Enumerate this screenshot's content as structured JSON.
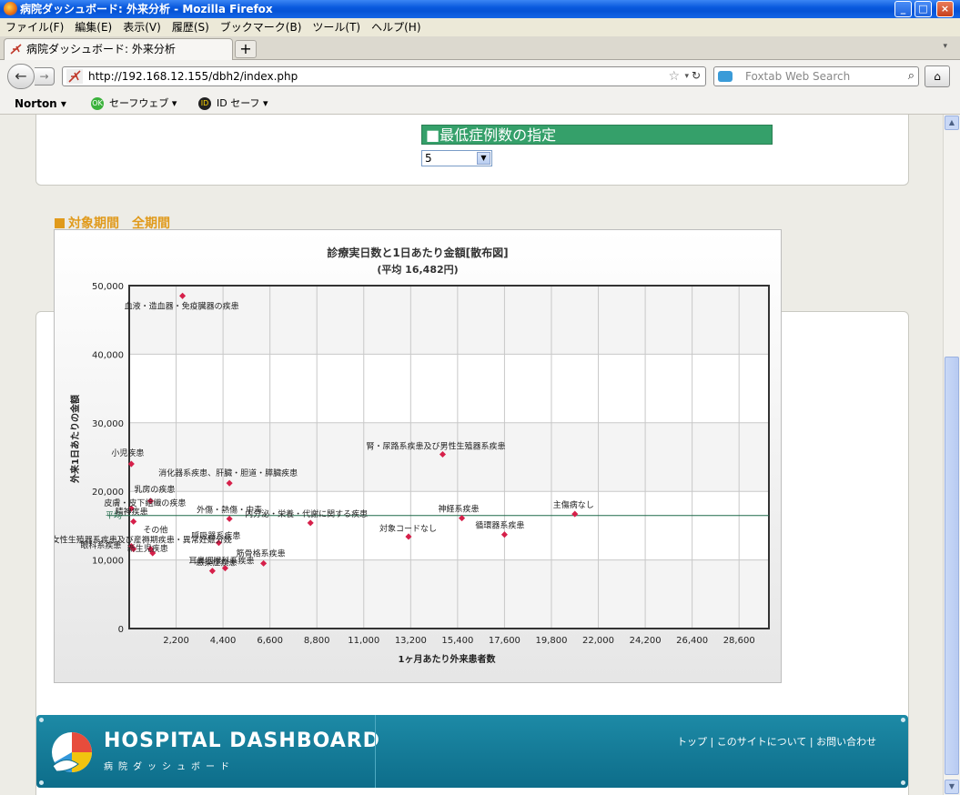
{
  "window": {
    "title": "病院ダッシュボード: 外来分析 - Mozilla Firefox",
    "min": "_",
    "max": "□",
    "close": "×"
  },
  "menu": [
    "ファイル(F)",
    "編集(E)",
    "表示(V)",
    "履歴(S)",
    "ブックマーク(B)",
    "ツール(T)",
    "ヘルプ(H)"
  ],
  "tab": {
    "title": "病院ダッシュボード: 外来分析",
    "new": "+"
  },
  "nav": {
    "url": "http://192.168.12.155/dbh2/index.php",
    "search_placeholder": "Foxtab Web Search",
    "back": "←",
    "forward": "→",
    "reload": "↻",
    "home": "⌂",
    "star": "☆",
    "drop": "▾",
    "mag": "⌕"
  },
  "toolbar2": {
    "norton": "Norton ▾",
    "safeweb": "セーフウェブ ▾",
    "safeweb_icon": "OK",
    "idsafe": "ID セーフ ▾",
    "idsafe_icon": "ID"
  },
  "filter": {
    "heading": "■最低症例数の指定",
    "value": "5",
    "arrow": "▼"
  },
  "period": {
    "label": "対象期間",
    "value": "全期間"
  },
  "chart_data": {
    "type": "scatter",
    "title": "診療実日数と1日あたり金額[散布図]",
    "subtitle": "(平均 16,482円)",
    "xlabel": "1ヶ月あたり外来患者数",
    "ylabel": "外来1日あたりの金額",
    "xticks": [
      "2,200",
      "4,400",
      "6,600",
      "8,800",
      "11,000",
      "13,200",
      "15,400",
      "17,600",
      "19,800",
      "22,000",
      "24,200",
      "26,400",
      "28,600"
    ],
    "yticks": [
      "0",
      "10,000",
      "20,000",
      "30,000",
      "40,000",
      "50,000"
    ],
    "xlim": [
      0,
      30000
    ],
    "ylim": [
      0,
      50000
    ],
    "average": 16482,
    "average_label": "平均",
    "points": [
      {
        "name": "血液・造血器・免疫臓器の疾患",
        "x": 2500,
        "y": 48500
      },
      {
        "name": "腎・尿路系疾患及び男性生殖器系疾患",
        "x": 14700,
        "y": 25400
      },
      {
        "name": "小児疾患",
        "x": 100,
        "y": 24000
      },
      {
        "name": "消化器系疾患、肝臓・胆道・膵臓疾患",
        "x": 4700,
        "y": 21200
      },
      {
        "name": "乳房の疾患",
        "x": 1000,
        "y": 18600
      },
      {
        "name": "皮膚・皮下組織の疾患",
        "x": 100,
        "y": 17500
      },
      {
        "name": "主傷病なし",
        "x": 20900,
        "y": 16700
      },
      {
        "name": "神経系疾患",
        "x": 15600,
        "y": 16100
      },
      {
        "name": "外傷・熱傷・中毒",
        "x": 4700,
        "y": 16000
      },
      {
        "name": "内分泌・栄養・代謝に関する疾患",
        "x": 8500,
        "y": 15400
      },
      {
        "name": "精神疾患",
        "x": 200,
        "y": 15600
      },
      {
        "name": "循環器系疾患",
        "x": 17600,
        "y": 13700
      },
      {
        "name": "対象コードなし",
        "x": 13100,
        "y": 13400
      },
      {
        "name": "呼吸器系疾患",
        "x": 4200,
        "y": 12500
      },
      {
        "name": "その他",
        "x": 1000,
        "y": 11600
      },
      {
        "name": "女性生殖器系疾患及び産褥期疾患・異常妊娠分娩",
        "x": 200,
        "y": 11600
      },
      {
        "name": "眼科系疾患",
        "x": 100,
        "y": 12000
      },
      {
        "name": "新生児疾患",
        "x": 1100,
        "y": 11000
      },
      {
        "name": "筋骨格系疾患",
        "x": 6300,
        "y": 9500
      },
      {
        "name": "耳鼻咽喉科系疾患",
        "x": 4500,
        "y": 8800
      },
      {
        "name": "感染症疾患",
        "x": 3900,
        "y": 8400
      }
    ]
  },
  "footer": {
    "logo": "HOSPITAL DASHBOARD",
    "logo_sub": "病院ダッシュボード",
    "links": "トップ | このサイトについて | お問い合わせ"
  }
}
